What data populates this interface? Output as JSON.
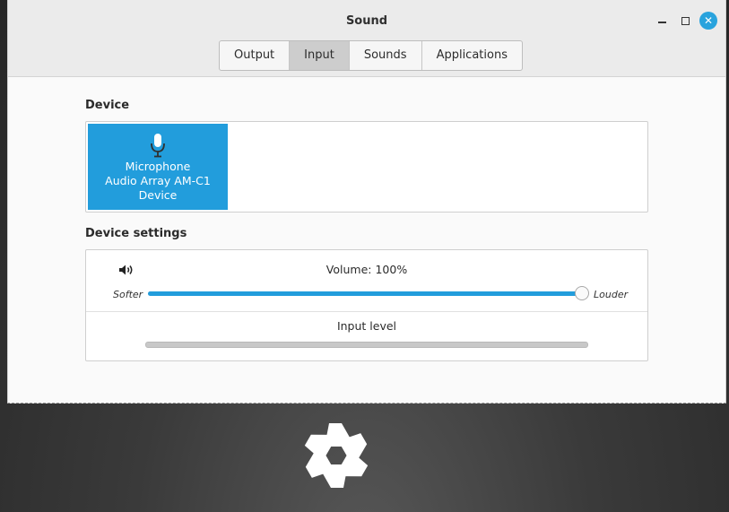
{
  "window": {
    "title": "Sound"
  },
  "tabs": [
    {
      "label": "Output",
      "active": false
    },
    {
      "label": "Input",
      "active": true
    },
    {
      "label": "Sounds",
      "active": false
    },
    {
      "label": "Applications",
      "active": false
    }
  ],
  "device_section": {
    "heading": "Device",
    "selected_device": {
      "icon": "microphone-icon",
      "line1": "Microphone",
      "line2": "Audio Array AM-C1",
      "line3": "Device"
    }
  },
  "settings_section": {
    "heading": "Device settings",
    "volume_label": "Volume: 100%",
    "volume_percent": 100,
    "softer_label": "Softer",
    "louder_label": "Louder",
    "input_level_label": "Input level",
    "input_level_percent": 0
  },
  "colors": {
    "accent": "#229ddc",
    "close_button": "#29a3dd"
  }
}
